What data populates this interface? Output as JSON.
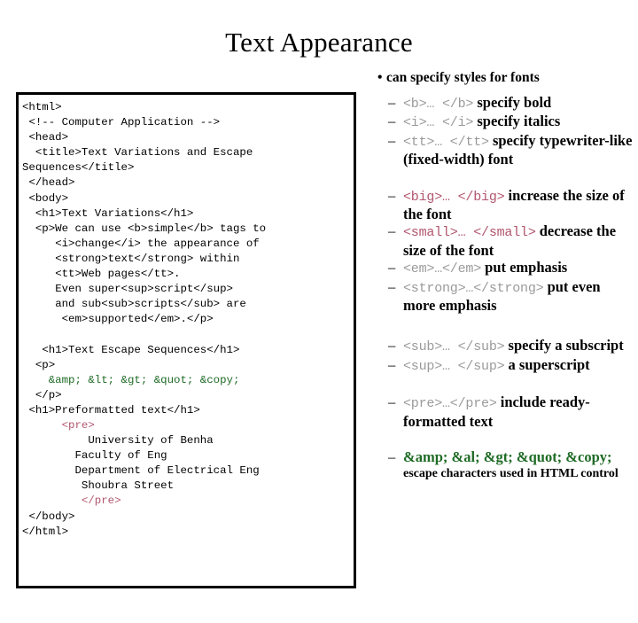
{
  "slide": {
    "title": "Text Appearance"
  },
  "bullets": {
    "lead": {
      "marker": "•",
      "text": "can specify styles for fonts"
    },
    "dash": "–",
    "groups": [
      {
        "items": [
          {
            "tag": "<b>… </b>",
            "tag_style": "gray",
            "desc": " specify bold"
          },
          {
            "tag": "<i>… </i>",
            "tag_style": "gray",
            "desc": " specify italics"
          },
          {
            "tag": "<tt>… </tt>",
            "tag_style": "gray",
            "desc": " specify typewriter-like (fixed-width) font"
          }
        ]
      },
      {
        "items": [
          {
            "tag": "<big>… </big>",
            "tag_style": "rose",
            "desc": " increase the size of the font"
          },
          {
            "tag": "<small>… </small>",
            "tag_style": "rose",
            "desc": " decrease the size of the font"
          },
          {
            "tag": "<em>…</em>",
            "tag_style": "gray",
            "desc": " put emphasis"
          },
          {
            "tag": "<strong>…</strong>",
            "tag_style": "gray",
            "desc": " put even more emphasis"
          }
        ]
      },
      {
        "items": [
          {
            "tag": "<sub>… </sub>",
            "tag_style": "gray",
            "desc": " specify a subscript"
          },
          {
            "tag": "<sup>… </sup>",
            "tag_style": "gray",
            "desc": " a superscript"
          }
        ]
      },
      {
        "items": [
          {
            "tag": "<pre>…</pre>",
            "tag_style": "gray",
            "desc": " include ready-formatted text"
          }
        ]
      },
      {
        "items": [
          {
            "entities": "&amp; &al; &gt; &quot; &copy;",
            "note": "escape characters used in HTML control"
          }
        ]
      }
    ]
  },
  "code": {
    "lines": [
      {
        "text": "<html>",
        "color": "black"
      },
      {
        "text": " <!-- Computer Application -->",
        "color": "black"
      },
      {
        "text": " <head>",
        "color": "black"
      },
      {
        "text": "  <title>Text Variations and Escape Sequences</title>",
        "color": "black"
      },
      {
        "text": " </head>",
        "color": "black"
      },
      {
        "text": " <body>",
        "color": "black"
      },
      {
        "text": "  <h1>Text Variations</h1>",
        "color": "black"
      },
      {
        "text": "  <p>We can use <b>simple</b> tags to",
        "color": "black"
      },
      {
        "text": "     <i>change</i> the appearance of",
        "color": "black"
      },
      {
        "text": "     <strong>text</strong> within",
        "color": "black"
      },
      {
        "text": "     <tt>Web pages</tt>.",
        "color": "black"
      },
      {
        "text": "     Even super<sup>script</sup>",
        "color": "black"
      },
      {
        "text": "     and sub<sub>scripts</sub> are",
        "color": "black"
      },
      {
        "text": "      <em>supported</em>.</p>",
        "color": "black"
      },
      {
        "text": "",
        "color": "black"
      },
      {
        "text": "   <h1>Text Escape Sequences</h1>",
        "color": "black"
      },
      {
        "text": "  <p>",
        "color": "black"
      },
      {
        "text": "    &amp; &lt; &gt; &quot; &copy;",
        "color": "green"
      },
      {
        "text": "  </p>",
        "color": "black"
      },
      {
        "text": " <h1>Preformatted text</h1>",
        "color": "black"
      },
      {
        "text": "      <pre>",
        "color": "rose"
      },
      {
        "text": "          University of Benha",
        "color": "black"
      },
      {
        "text": "        Faculty of Eng",
        "color": "black"
      },
      {
        "text": "        Department of Electrical Eng",
        "color": "black"
      },
      {
        "text": "         Shoubra Street",
        "color": "black"
      },
      {
        "text": "         </pre>",
        "color": "rose"
      },
      {
        "text": " </body>",
        "color": "black"
      },
      {
        "text": "</html>",
        "color": "black"
      }
    ]
  }
}
